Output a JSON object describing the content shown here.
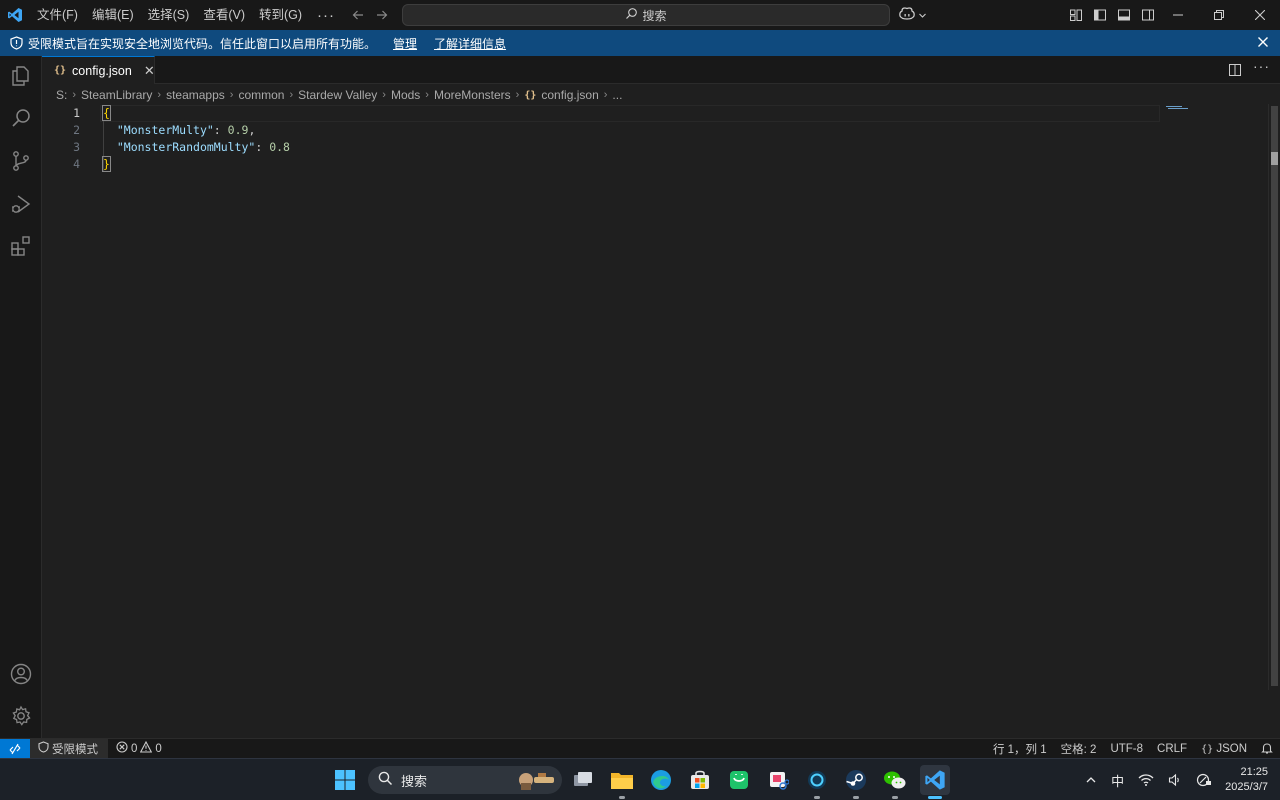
{
  "titlebar": {
    "menu": [
      "文件(F)",
      "编辑(E)",
      "选择(S)",
      "查看(V)",
      "转到(G)"
    ],
    "more": "···",
    "search_label": "搜索"
  },
  "banner": {
    "text": "受限模式旨在实现安全地浏览代码。信任此窗口以启用所有功能。",
    "manage_link": "管理",
    "learn_link": "了解详细信息"
  },
  "tab": {
    "label": "config.json",
    "file_icon": "{}",
    "close": "✕",
    "more": "···"
  },
  "breadcrumb": [
    "S:",
    "SteamLibrary",
    "steamapps",
    "common",
    "Stardew Valley",
    "Mods",
    "MoreMonsters"
  ],
  "breadcrumb_file": "config.json",
  "breadcrumb_tail": "...",
  "editor": {
    "line_numbers": [
      "1",
      "2",
      "3",
      "4"
    ],
    "open_brace": "{",
    "close_brace": "}",
    "key1": "\"MonsterMulty\"",
    "value1": "0.9",
    "key2": "\"MonsterRandomMulty\"",
    "value2": "0.8"
  },
  "statusbar": {
    "restricted": "受限模式",
    "errors": "0",
    "warnings": "0",
    "position": "行 1，列 1",
    "spaces": "空格: 2",
    "encoding": "UTF-8",
    "eol": "CRLF",
    "language": "JSON"
  },
  "taskbar": {
    "search_label": "搜索",
    "ime": "中",
    "time": "21:25",
    "date": "2025/3/7"
  },
  "colors": {
    "accent": "#0078d4",
    "banner": "#0f4a7e",
    "json_key": "#9cdcfe",
    "json_number": "#b5cea8",
    "brace_highlight": "#ffd700"
  }
}
